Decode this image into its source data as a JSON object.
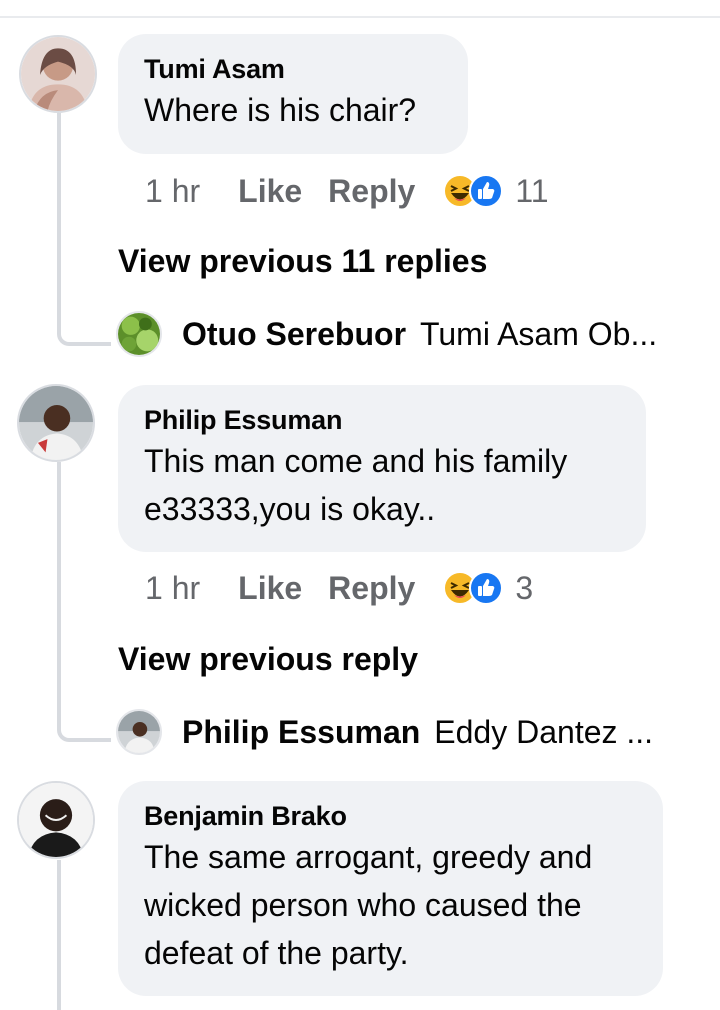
{
  "comments": [
    {
      "author": "Tumi Asam",
      "text": "Where is his chair?",
      "time": "1 hr",
      "like_label": "Like",
      "reply_label": "Reply",
      "reaction_count": "11",
      "view_replies_label": "View previous 11 replies",
      "latest_reply": {
        "author": "Otuo Serebuor",
        "preview": "Tumi Asam Ob..."
      }
    },
    {
      "author": "Philip Essuman",
      "text_lines": [
        "This man come and his family",
        "e33333,you is okay.."
      ],
      "time": "1 hr",
      "like_label": "Like",
      "reply_label": "Reply",
      "reaction_count": "3",
      "view_replies_label": "View previous reply",
      "latest_reply": {
        "author": "Philip Essuman",
        "preview": "Eddy Dantez ..."
      }
    },
    {
      "author": "Benjamin Brako",
      "text_lines": [
        "The same arrogant, greedy and",
        "wicked person who caused the",
        "defeat of the party."
      ]
    }
  ],
  "colors": {
    "bubble_bg": "#f0f2f5",
    "meta_text": "#65676b",
    "thread_line": "#d7dadf",
    "like_blue": "#1877f2",
    "haha_yellow": "#f7b928"
  },
  "icons": [
    "haha-reaction-icon",
    "like-reaction-icon"
  ]
}
